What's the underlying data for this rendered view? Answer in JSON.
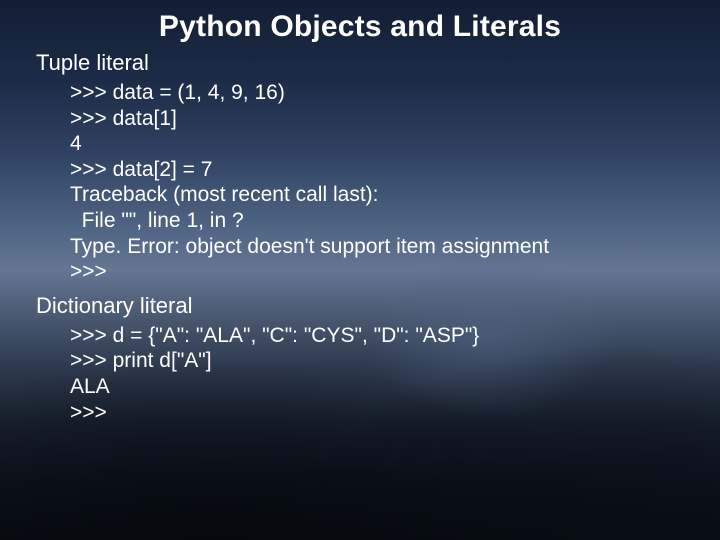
{
  "title": "Python Objects and Literals",
  "section1": {
    "label": "Tuple literal",
    "lines": [
      ">>> data = (1, 4, 9, 16)",
      ">>> data[1]",
      "4",
      ">>> data[2] = 7",
      "Traceback (most recent call last):",
      "  File \"\", line 1, in ?",
      "Type. Error: object doesn't support item assignment",
      ">>>"
    ]
  },
  "section2": {
    "label": "Dictionary literal",
    "lines": [
      ">>> d = {\"A\": \"ALA\", \"C\": \"CYS\", \"D\": \"ASP\"}",
      ">>> print d[\"A\"]",
      "ALA",
      ">>>"
    ]
  }
}
